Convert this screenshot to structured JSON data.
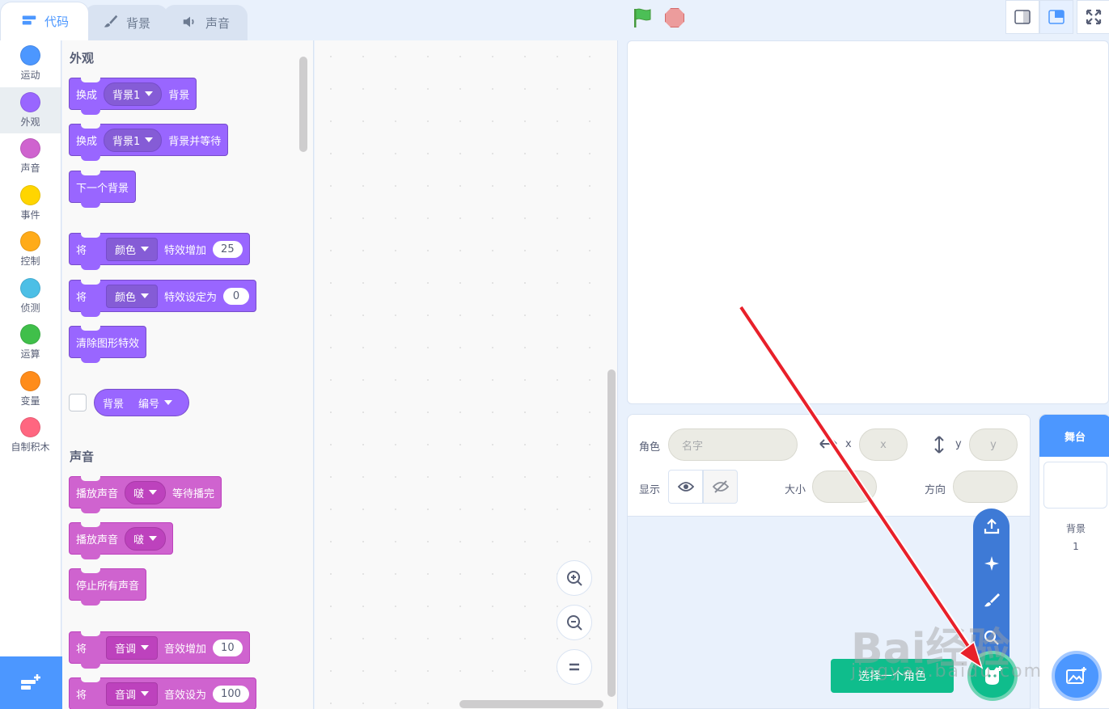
{
  "tabs": [
    {
      "label": "代码",
      "icon": "code-icon"
    },
    {
      "label": "背景",
      "icon": "brush-icon"
    },
    {
      "label": "声音",
      "icon": "speaker-icon"
    }
  ],
  "categories": [
    {
      "label": "运动",
      "color": "#4c97ff"
    },
    {
      "label": "外观",
      "color": "#9966ff"
    },
    {
      "label": "声音",
      "color": "#cf63cf"
    },
    {
      "label": "事件",
      "color": "#ffd500"
    },
    {
      "label": "控制",
      "color": "#ffab19"
    },
    {
      "label": "侦测",
      "color": "#4cbfe6"
    },
    {
      "label": "运算",
      "color": "#40bf4a"
    },
    {
      "label": "变量",
      "color": "#ff8c1a"
    },
    {
      "label": "自制积木",
      "color": "#ff6680"
    }
  ],
  "palette": {
    "looks_title": "外观",
    "sound_title": "声音",
    "b1": {
      "pre": "换成",
      "dd": "背景1",
      "post": "背景"
    },
    "b2": {
      "pre": "换成",
      "dd": "背景1",
      "post": "背景并等待"
    },
    "b3": {
      "text": "下一个背景"
    },
    "b4": {
      "pre": "将",
      "dd": "颜色",
      "post": "特效增加",
      "num": "25"
    },
    "b5": {
      "pre": "将",
      "dd": "颜色",
      "post": "特效设定为",
      "num": "0"
    },
    "b6": {
      "text": "清除图形特效"
    },
    "reporter": {
      "pre": "背景",
      "dd": "编号"
    },
    "s1": {
      "pre": "播放声音",
      "dd": "啵",
      "post": "等待播完"
    },
    "s2": {
      "pre": "播放声音",
      "dd": "啵"
    },
    "s3": {
      "text": "停止所有声音"
    },
    "s4": {
      "pre": "将",
      "dd": "音调",
      "post": "音效增加",
      "num": "10"
    },
    "s5": {
      "pre": "将",
      "dd": "音调",
      "post": "音效设为",
      "num": "100"
    }
  },
  "sprite_info": {
    "sprite_label": "角色",
    "name_placeholder": "名字",
    "x_label": "x",
    "x_placeholder": "x",
    "y_label": "y",
    "y_placeholder": "y",
    "show_label": "显示",
    "size_label": "大小",
    "direction_label": "方向"
  },
  "add_sprite_tooltip": "选择一个角色",
  "stage_pane": {
    "title": "舞台",
    "backdrops_label": "背景",
    "backdrops_count": "1"
  },
  "watermark": {
    "brand": "Bai经验",
    "url": "jingyan.baidu.com"
  },
  "colors": {
    "accent": "#4c97ff",
    "looks": "#9966ff",
    "sound": "#cf63cf",
    "add_sprite": "#0fbd8c",
    "arrow": "#e8202a"
  }
}
